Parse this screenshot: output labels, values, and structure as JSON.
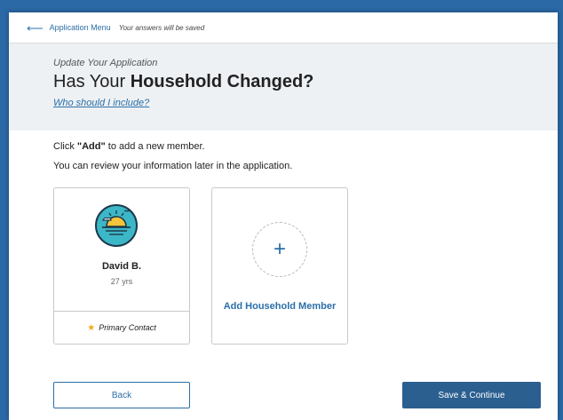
{
  "topbar": {
    "back_arrow": "⟵",
    "menu_label": "Application Menu",
    "saved_note": "Your answers will be saved"
  },
  "header": {
    "subtitle": "Update Your Application",
    "title_prefix": "Has Your ",
    "title_bold": "Household Changed?",
    "include_link": "Who should I include?"
  },
  "instructions": {
    "line1_prefix": "Click ",
    "line1_bold": "\"Add\"",
    "line1_suffix": " to add a new member.",
    "line2": "You can review your information later in the application."
  },
  "members": [
    {
      "name": "David B.",
      "age": "27 yrs",
      "role": "Primary Contact",
      "avatar_icon": "sunrise-avatar-icon"
    }
  ],
  "add_card": {
    "plus": "+",
    "label": "Add Household Member"
  },
  "buttons": {
    "back": "Back",
    "save_continue": "Save & Continue"
  },
  "colors": {
    "accent": "#2a6fa8",
    "primary_button": "#2b5f8f",
    "header_bg": "#eef1f4",
    "avatar_bg": "#3cb7c8",
    "star": "#f0a91a"
  }
}
